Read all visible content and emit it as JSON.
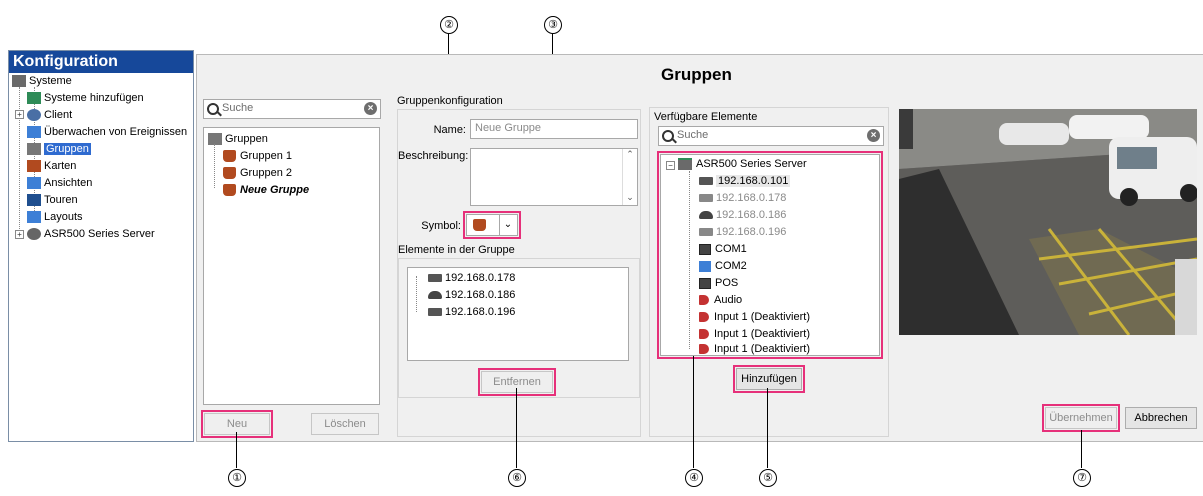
{
  "nav": {
    "title": "Konfiguration",
    "items": [
      {
        "label": "Systeme",
        "icon": "systems-icon"
      },
      {
        "label": "Systeme hinzufügen",
        "icon": "add-system-icon"
      },
      {
        "label": "Client",
        "icon": "gear-icon"
      },
      {
        "label": "Überwachen von Ereignissen",
        "icon": "event-monitor-icon"
      },
      {
        "label": "Gruppen",
        "icon": "group-icon",
        "selected": true
      },
      {
        "label": "Karten",
        "icon": "map-icon"
      },
      {
        "label": "Ansichten",
        "icon": "views-icon"
      },
      {
        "label": "Touren",
        "icon": "tours-icon"
      },
      {
        "label": "Layouts",
        "icon": "layouts-icon"
      },
      {
        "label": "ASR500 Series Server",
        "icon": "server-icon"
      }
    ]
  },
  "page_title": "Gruppen",
  "group_list": {
    "search_placeholder": "Suche",
    "root": "Gruppen",
    "items": [
      "Gruppen 1",
      "Gruppen 2",
      "Neue Gruppe"
    ],
    "new_button": "Neu",
    "delete_button": "Löschen"
  },
  "group_config": {
    "section_title": "Gruppenkonfiguration",
    "name_label": "Name:",
    "name_value": "Neue Gruppe",
    "description_label": "Beschreibung:",
    "symbol_label": "Symbol:",
    "elements_title": "Elemente in der Gruppe",
    "elements": [
      "192.168.0.178",
      "192.168.0.186",
      "192.168.0.196"
    ],
    "remove_button": "Entfernen"
  },
  "available": {
    "title": "Verfügbare Elemente",
    "search_placeholder": "Suche",
    "server": "ASR500 Series Server",
    "items": [
      {
        "label": "192.168.0.101",
        "icon": "camera-icon",
        "dim": false,
        "highlight": true
      },
      {
        "label": "192.168.0.178",
        "icon": "camera-icon",
        "dim": true
      },
      {
        "label": "192.168.0.186",
        "icon": "dome-camera-icon",
        "dim": true
      },
      {
        "label": "192.168.0.196",
        "icon": "camera-icon",
        "dim": true
      },
      {
        "label": "COM1",
        "icon": "com-port-icon",
        "dim": false
      },
      {
        "label": "COM2",
        "icon": "com-port-icon",
        "dim": false
      },
      {
        "label": "POS",
        "icon": "pos-icon",
        "dim": false
      },
      {
        "label": "Audio",
        "icon": "audio-icon",
        "dim": false
      },
      {
        "label": "Input 1 (Deaktiviert)",
        "icon": "audio-icon",
        "dim": false
      },
      {
        "label": "Input 1 (Deaktiviert)",
        "icon": "audio-icon",
        "dim": false
      },
      {
        "label": "Input 1 (Deaktiviert)",
        "icon": "audio-icon",
        "dim": false
      }
    ],
    "add_button": "Hinzufügen"
  },
  "footer": {
    "apply_button": "Übernehmen",
    "cancel_button": "Abbrechen"
  },
  "callouts": [
    "①",
    "②",
    "③",
    "④",
    "⑤",
    "⑥",
    "⑦"
  ],
  "colors": {
    "nav_header": "#16489a",
    "selection": "#2f6bd0",
    "highlight_outline": "#e6307a"
  }
}
